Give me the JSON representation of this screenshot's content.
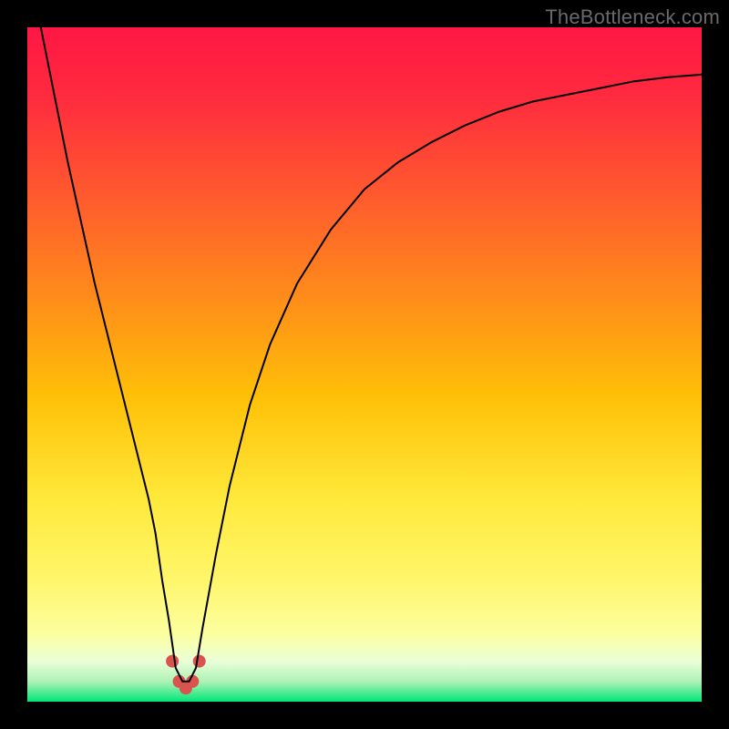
{
  "watermark": {
    "text": "TheBottleneck.com"
  },
  "chart_data": {
    "type": "line",
    "title": "",
    "xlabel": "",
    "ylabel": "",
    "xlim": [
      0,
      100
    ],
    "ylim": [
      0,
      100
    ],
    "grid": false,
    "legend": false,
    "background_gradient": {
      "stops": [
        {
          "offset": 0.0,
          "color": "#ff1744"
        },
        {
          "offset": 0.1,
          "color": "#ff2a3f"
        },
        {
          "offset": 0.25,
          "color": "#ff5a2e"
        },
        {
          "offset": 0.4,
          "color": "#ff8c1a"
        },
        {
          "offset": 0.55,
          "color": "#ffc107"
        },
        {
          "offset": 0.7,
          "color": "#ffe93b"
        },
        {
          "offset": 0.82,
          "color": "#fff66b"
        },
        {
          "offset": 0.9,
          "color": "#fcffa0"
        },
        {
          "offset": 0.94,
          "color": "#eaffd8"
        },
        {
          "offset": 0.97,
          "color": "#aef2b6"
        },
        {
          "offset": 1.0,
          "color": "#00e676"
        }
      ]
    },
    "series": [
      {
        "name": "bottleneck-curve",
        "color": "#000000",
        "stroke_width": 2,
        "x": [
          2,
          4,
          6,
          8,
          10,
          12,
          14,
          16,
          18,
          19,
          20,
          21,
          22,
          23,
          24,
          25,
          26,
          28,
          30,
          33,
          36,
          40,
          45,
          50,
          55,
          60,
          65,
          70,
          75,
          80,
          85,
          90,
          95,
          100
        ],
        "values": [
          100,
          90,
          80,
          71,
          62,
          54,
          46,
          38,
          30,
          25,
          18,
          12,
          5,
          3,
          3,
          5,
          11,
          22,
          32,
          44,
          53,
          62,
          70,
          76,
          80,
          83,
          85.5,
          87.5,
          89,
          90,
          91,
          92,
          92.6,
          93
        ]
      }
    ],
    "markers": [
      {
        "name": "trough-marker",
        "color": "#d9534f",
        "radius": 7,
        "points": [
          {
            "x": 21.5,
            "y": 6
          },
          {
            "x": 22.5,
            "y": 3
          },
          {
            "x": 23.5,
            "y": 2
          },
          {
            "x": 24.5,
            "y": 3
          },
          {
            "x": 25.5,
            "y": 6
          }
        ]
      }
    ]
  }
}
